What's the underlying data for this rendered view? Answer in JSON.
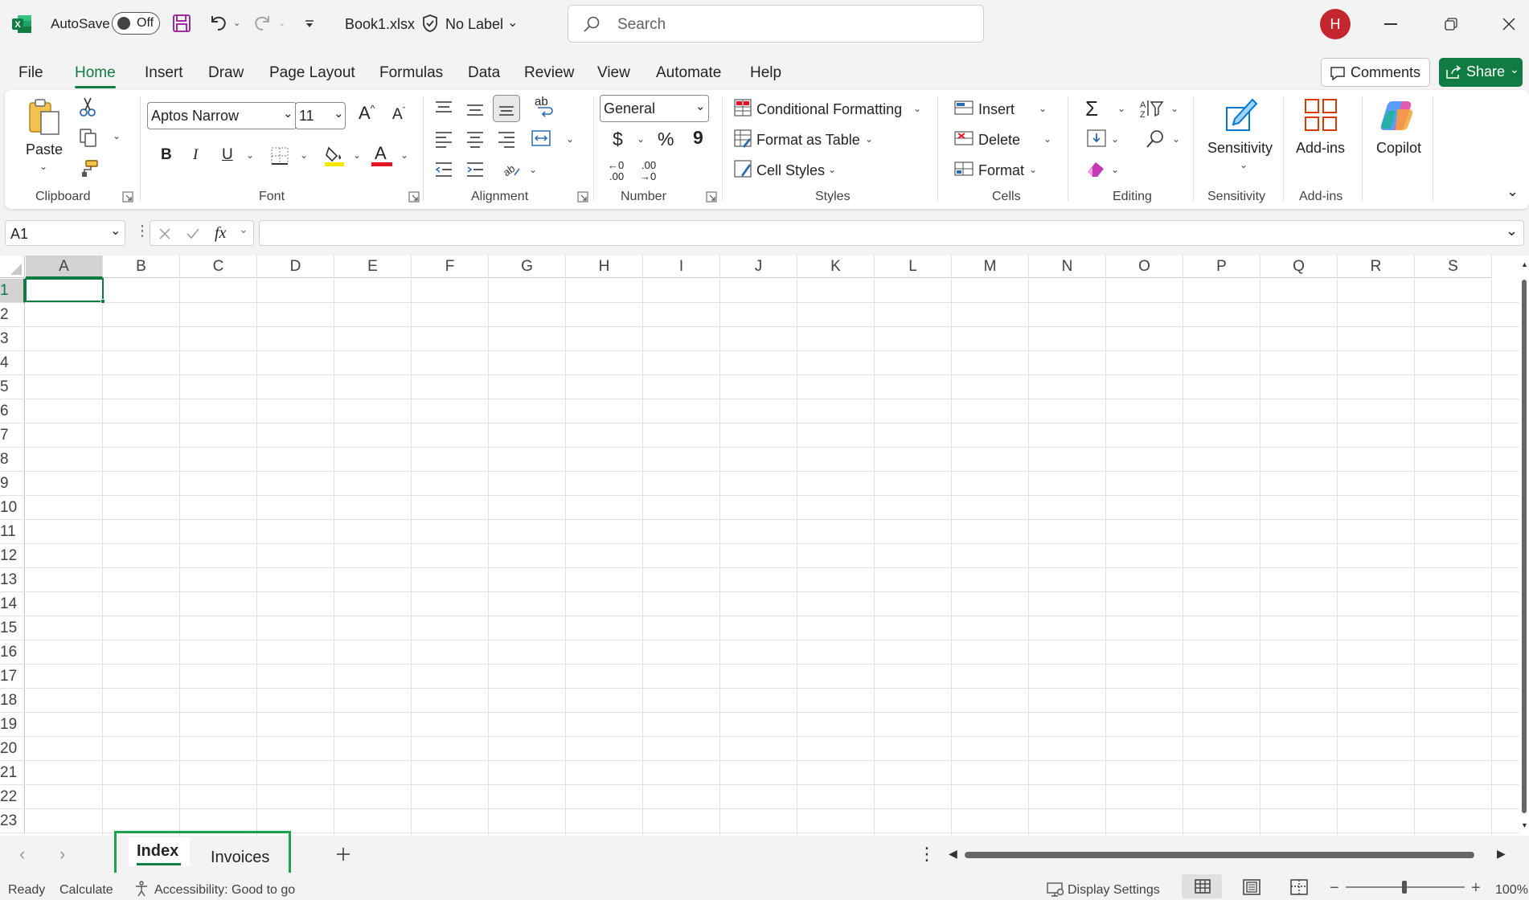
{
  "titlebar": {
    "autosave_label": "AutoSave",
    "autosave_state": "Off",
    "filename": "Book1.xlsx",
    "label_name": "No Label",
    "search_placeholder": "Search",
    "avatar_initial": "H"
  },
  "menu": {
    "tabs": [
      "File",
      "Home",
      "Insert",
      "Draw",
      "Page Layout",
      "Formulas",
      "Data",
      "Review",
      "View",
      "Automate",
      "Help"
    ],
    "active_tab": "Home",
    "comments_label": "Comments",
    "share_label": "Share"
  },
  "ribbon": {
    "clipboard": {
      "paste_label": "Paste",
      "group": "Clipboard"
    },
    "font": {
      "font_name": "Aptos Narrow",
      "font_size": "11",
      "bold": "B",
      "italic": "I",
      "underline": "U",
      "grow": "A",
      "shrink": "A",
      "color_glyph": "A",
      "group": "Font"
    },
    "alignment": {
      "group": "Alignment",
      "wrap_glyph": "ab"
    },
    "number": {
      "format": "General",
      "currency": "$",
      "percent": "%",
      "comma": "9",
      "inc_dec": ".00",
      "dec_dec": ".00",
      "inc_dec_sub": "←0",
      "dec_dec_sub": "→0",
      "group": "Number"
    },
    "styles": {
      "conditional": "Conditional Formatting",
      "format_table": "Format as Table",
      "cell_styles": "Cell Styles",
      "group": "Styles"
    },
    "cells": {
      "insert": "Insert",
      "delete": "Delete",
      "format": "Format",
      "group": "Cells"
    },
    "editing": {
      "group": "Editing"
    },
    "sensitivity": {
      "label": "Sensitivity",
      "group": "Sensitivity"
    },
    "addins": {
      "label": "Add-ins",
      "group": "Add-ins"
    },
    "copilot": {
      "label": "Copilot"
    }
  },
  "formula_bar": {
    "name_box": "A1",
    "fx": "fx",
    "value": ""
  },
  "grid": {
    "columns": [
      "A",
      "B",
      "C",
      "D",
      "E",
      "F",
      "G",
      "H",
      "I",
      "J",
      "K",
      "L",
      "M",
      "N",
      "O",
      "P",
      "Q",
      "R",
      "S"
    ],
    "rows": [
      "1",
      "2",
      "3",
      "4",
      "5",
      "6",
      "7",
      "8",
      "9",
      "10",
      "11",
      "12",
      "13",
      "14",
      "15",
      "16",
      "17",
      "18",
      "19",
      "20",
      "21",
      "22",
      "23"
    ],
    "selected_cell": "A1"
  },
  "sheets": {
    "tabs": [
      "Index",
      "Invoices"
    ],
    "active": "Index",
    "highlight_color": "#1aa34a"
  },
  "status": {
    "ready": "Ready",
    "calculate": "Calculate",
    "accessibility": "Accessibility: Good to go",
    "display_settings": "Display Settings",
    "zoom": "100%"
  },
  "colors": {
    "accent": "#107c41",
    "share_bg": "#107c41",
    "avatar_bg": "#c4262e"
  }
}
